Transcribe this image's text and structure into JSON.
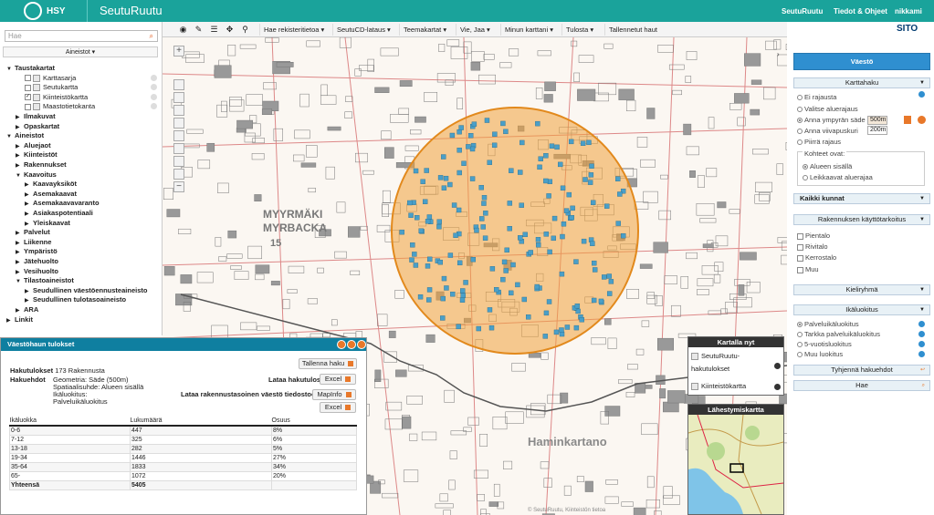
{
  "header": {
    "logo_text": "HSY",
    "app_title": "SeutuRuutu",
    "nav": [
      "SeutuRuutu",
      "Tiedot & Ohjeet",
      "nikkami"
    ]
  },
  "toolbar": {
    "menus": [
      "Hae rekisteritietoa",
      "SeutuCD-lataus",
      "Teemakartat",
      "Vie, Jaa",
      "Minun karttani",
      "Tulosta",
      "Tallennetut haut"
    ],
    "brand": "SITO"
  },
  "left": {
    "search_placeholder": "Hae",
    "header": "Aineistot",
    "tree": [
      {
        "label": "Taustakartat",
        "bold": true,
        "arrow": "▼",
        "indent": 0
      },
      {
        "label": "Karttasarja",
        "indent": 2,
        "check": false
      },
      {
        "label": "Seutukartta",
        "indent": 2,
        "check": false
      },
      {
        "label": "Kiinteistökartta",
        "indent": 2,
        "check": true
      },
      {
        "label": "Maastotietokanta",
        "indent": 2,
        "check": false
      },
      {
        "label": "Ilmakuvat",
        "bold": true,
        "arrow": "▶",
        "indent": 1
      },
      {
        "label": "Opaskartat",
        "bold": true,
        "arrow": "▶",
        "indent": 1
      },
      {
        "label": "Aineistot",
        "bold": true,
        "arrow": "▼",
        "indent": 0
      },
      {
        "label": "Aluejaot",
        "bold": true,
        "arrow": "▶",
        "indent": 1
      },
      {
        "label": "Kiinteistöt",
        "bold": true,
        "arrow": "▶",
        "indent": 1
      },
      {
        "label": "Rakennukset",
        "bold": true,
        "arrow": "▶",
        "indent": 1
      },
      {
        "label": "Kaavoitus",
        "bold": true,
        "arrow": "▼",
        "indent": 1
      },
      {
        "label": "Kaavayksiköt",
        "bold": true,
        "arrow": "▶",
        "indent": 2
      },
      {
        "label": "Asemakaavat",
        "bold": true,
        "arrow": "▶",
        "indent": 2
      },
      {
        "label": "Asemakaavavaranto",
        "bold": true,
        "arrow": "▶",
        "indent": 2
      },
      {
        "label": "Asiakaspotentiaali",
        "bold": true,
        "arrow": "▶",
        "indent": 2
      },
      {
        "label": "Yleiskaavat",
        "bold": true,
        "arrow": "▶",
        "indent": 2
      },
      {
        "label": "Palvelut",
        "bold": true,
        "arrow": "▶",
        "indent": 1
      },
      {
        "label": "Liikenne",
        "bold": true,
        "arrow": "▶",
        "indent": 1
      },
      {
        "label": "Ympäristö",
        "bold": true,
        "arrow": "▶",
        "indent": 1
      },
      {
        "label": "Jätehuolto",
        "bold": true,
        "arrow": "▶",
        "indent": 1
      },
      {
        "label": "Vesihuolto",
        "bold": true,
        "arrow": "▶",
        "indent": 1
      },
      {
        "label": "Tilastoaineistot",
        "bold": true,
        "arrow": "▼",
        "indent": 1
      },
      {
        "label": "Seudullinen väestöennusteaineisto",
        "bold": true,
        "arrow": "▶",
        "indent": 2
      },
      {
        "label": "Seudullinen tulotasoaineisto",
        "bold": true,
        "arrow": "▶",
        "indent": 2
      },
      {
        "label": "ARA",
        "bold": true,
        "arrow": "▶",
        "indent": 1
      },
      {
        "label": "Linkit",
        "bold": true,
        "arrow": "▶",
        "indent": 0
      }
    ]
  },
  "results": {
    "title": "Väestöhaun tulokset",
    "save_label": "Tallenna haku",
    "hakutulokset_label": "Hakutulokset",
    "hakutulokset_value": "173 Rakennusta",
    "hakuehdot_label": "Hakuehdot",
    "hakuehdot_lines": [
      "Geometria: Säde (500m)",
      "Spatiaalisuhde: Alueen sisällä",
      "Ikäluokitus:",
      "Palveluikäluokitus"
    ],
    "lataa_hakutulos": "Lataa hakutulos:",
    "lataa_rak": "Lataa rakennustasoinen väestö tiedostoon:",
    "excel": "Excel",
    "mapinfo": "MapInfo",
    "columns": [
      "Ikäluokka",
      "Lukumäärä",
      "Osuus"
    ],
    "rows": [
      [
        "0-6",
        "447",
        "8%"
      ],
      [
        "7-12",
        "325",
        "6%"
      ],
      [
        "13-18",
        "282",
        "5%"
      ],
      [
        "19-34",
        "1446",
        "27%"
      ],
      [
        "35-64",
        "1833",
        "34%"
      ],
      [
        "65-",
        "1072",
        "20%"
      ],
      [
        "Yhteensä",
        "5405",
        ""
      ]
    ]
  },
  "kartalla": {
    "title": "Kartalla nyt",
    "item1": "SeutuRuutu-",
    "item1b": "hakutulokset",
    "item2": "Kiinteistökartta"
  },
  "lahesty": {
    "title": "Lähestymiskartta"
  },
  "map": {
    "labels": [
      "MYYRMÄKI",
      "MYRBACKA",
      "15",
      "Haminkartano"
    ],
    "copyright": "© SeutuRuutu, Kiinteistön tietoa"
  },
  "right": {
    "vaesto": "Väestö",
    "karttahaku": "Karttahaku",
    "radios": [
      "Ei rajausta",
      "Valitse aluerajaus",
      "Anna ympyrän säde",
      "Anna viivapuskuri",
      "Piirrä rajaus"
    ],
    "radius": "500m",
    "buffer": "200m",
    "kohteet_label": "Kohteet ovat:",
    "kohteet": [
      "Alueen sisällä",
      "Leikkaavat aluerajaa"
    ],
    "kaikki_kunnat": "Kaikki kunnat",
    "kayttotarkoitus": "Rakennuksen käyttötarkoitus",
    "kt_opts": [
      "Pientalo",
      "Rivitalo",
      "Kerrostalo",
      "Muu"
    ],
    "kieliryhma": "Kieliryhmä",
    "ikaluokitus": "Ikäluokitus",
    "ika_opts": [
      "Palveluikäluokitus",
      "Tarkka palveluikäluokitus",
      "5-vuotisluokitus",
      "Muu luokitus"
    ],
    "tyhjenna": "Tyhjennä hakuehdot",
    "hae": "Hae"
  },
  "colors": {
    "topbar": "#1aa39b",
    "circle": "#f0a23c",
    "results_header": "#0f7fa0",
    "accent": "#2f8fd0"
  }
}
